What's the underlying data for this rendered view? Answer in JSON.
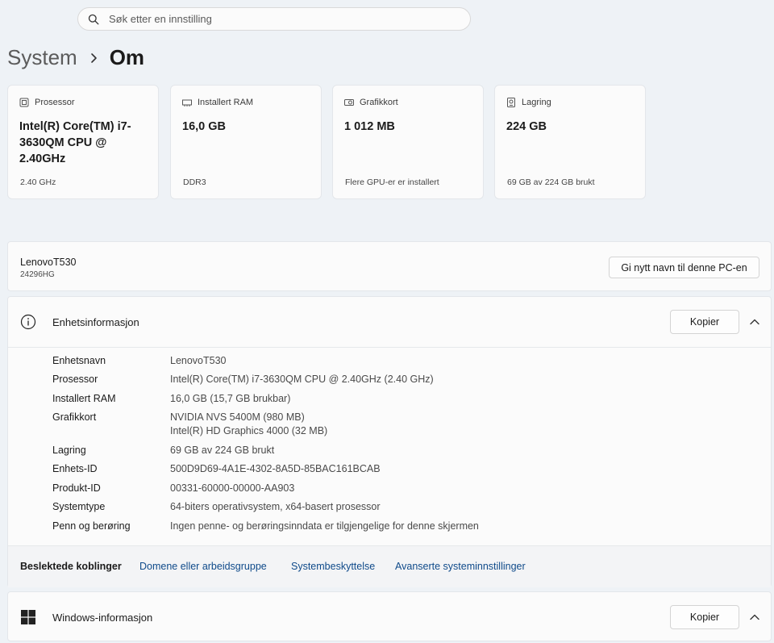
{
  "search": {
    "placeholder": "Søk etter en innstilling"
  },
  "breadcrumb": {
    "parent": "System",
    "current": "Om"
  },
  "cards": [
    {
      "label": "Prosessor",
      "icon": "cpu-icon",
      "value": "Intel(R) Core(TM) i7-3630QM CPU @ 2.40GHz",
      "sub": "2.40 GHz"
    },
    {
      "label": "Installert RAM",
      "icon": "ram-icon",
      "value": "16,0 GB",
      "sub": "DDR3"
    },
    {
      "label": "Grafikkort",
      "icon": "gpu-icon",
      "value": "1 012 MB",
      "sub": "Flere GPU-er er installert"
    },
    {
      "label": "Lagring",
      "icon": "storage-icon",
      "value": "224 GB",
      "sub": "69 GB av 224 GB brukt"
    }
  ],
  "pc": {
    "name": "LenovoT530",
    "model": "24296HG",
    "rename_label": "Gi nytt navn til denne PC-en"
  },
  "device_info": {
    "title": "Enhetsinformasjon",
    "copy_label": "Kopier",
    "rows": [
      {
        "key": "Enhetsnavn",
        "value": "LenovoT530"
      },
      {
        "key": "Prosessor",
        "value": "Intel(R) Core(TM) i7-3630QM CPU @ 2.40GHz (2.40 GHz)"
      },
      {
        "key": "Installert RAM",
        "value": "16,0 GB (15,7 GB brukbar)"
      },
      {
        "key": "Grafikkort",
        "value": "NVIDIA NVS 5400M (980 MB)",
        "value2": "Intel(R) HD Graphics 4000 (32 MB)"
      },
      {
        "key": "Lagring",
        "value": "69 GB av 224 GB brukt"
      },
      {
        "key": "Enhets-ID",
        "value": "500D9D69-4A1E-4302-8A5D-85BAC161BCAB"
      },
      {
        "key": "Produkt-ID",
        "value": "00331-60000-00000-AA903"
      },
      {
        "key": "Systemtype",
        "value": "64-biters operativsystem, x64-basert prosessor"
      },
      {
        "key": "Penn og berøring",
        "value": "Ingen penne- og berøringsinndata er tilgjengelige for denne skjermen"
      }
    ],
    "related_label": "Beslektede koblinger",
    "links": [
      "Domene eller arbeidsgruppe",
      "Systembeskyttelse",
      "Avanserte systeminnstillinger"
    ]
  },
  "windows_info": {
    "title": "Windows-informasjon",
    "copy_label": "Kopier"
  },
  "colors": {
    "background": "#eef2f6",
    "card": "#fbfbfb",
    "link": "#0f4a8a"
  }
}
